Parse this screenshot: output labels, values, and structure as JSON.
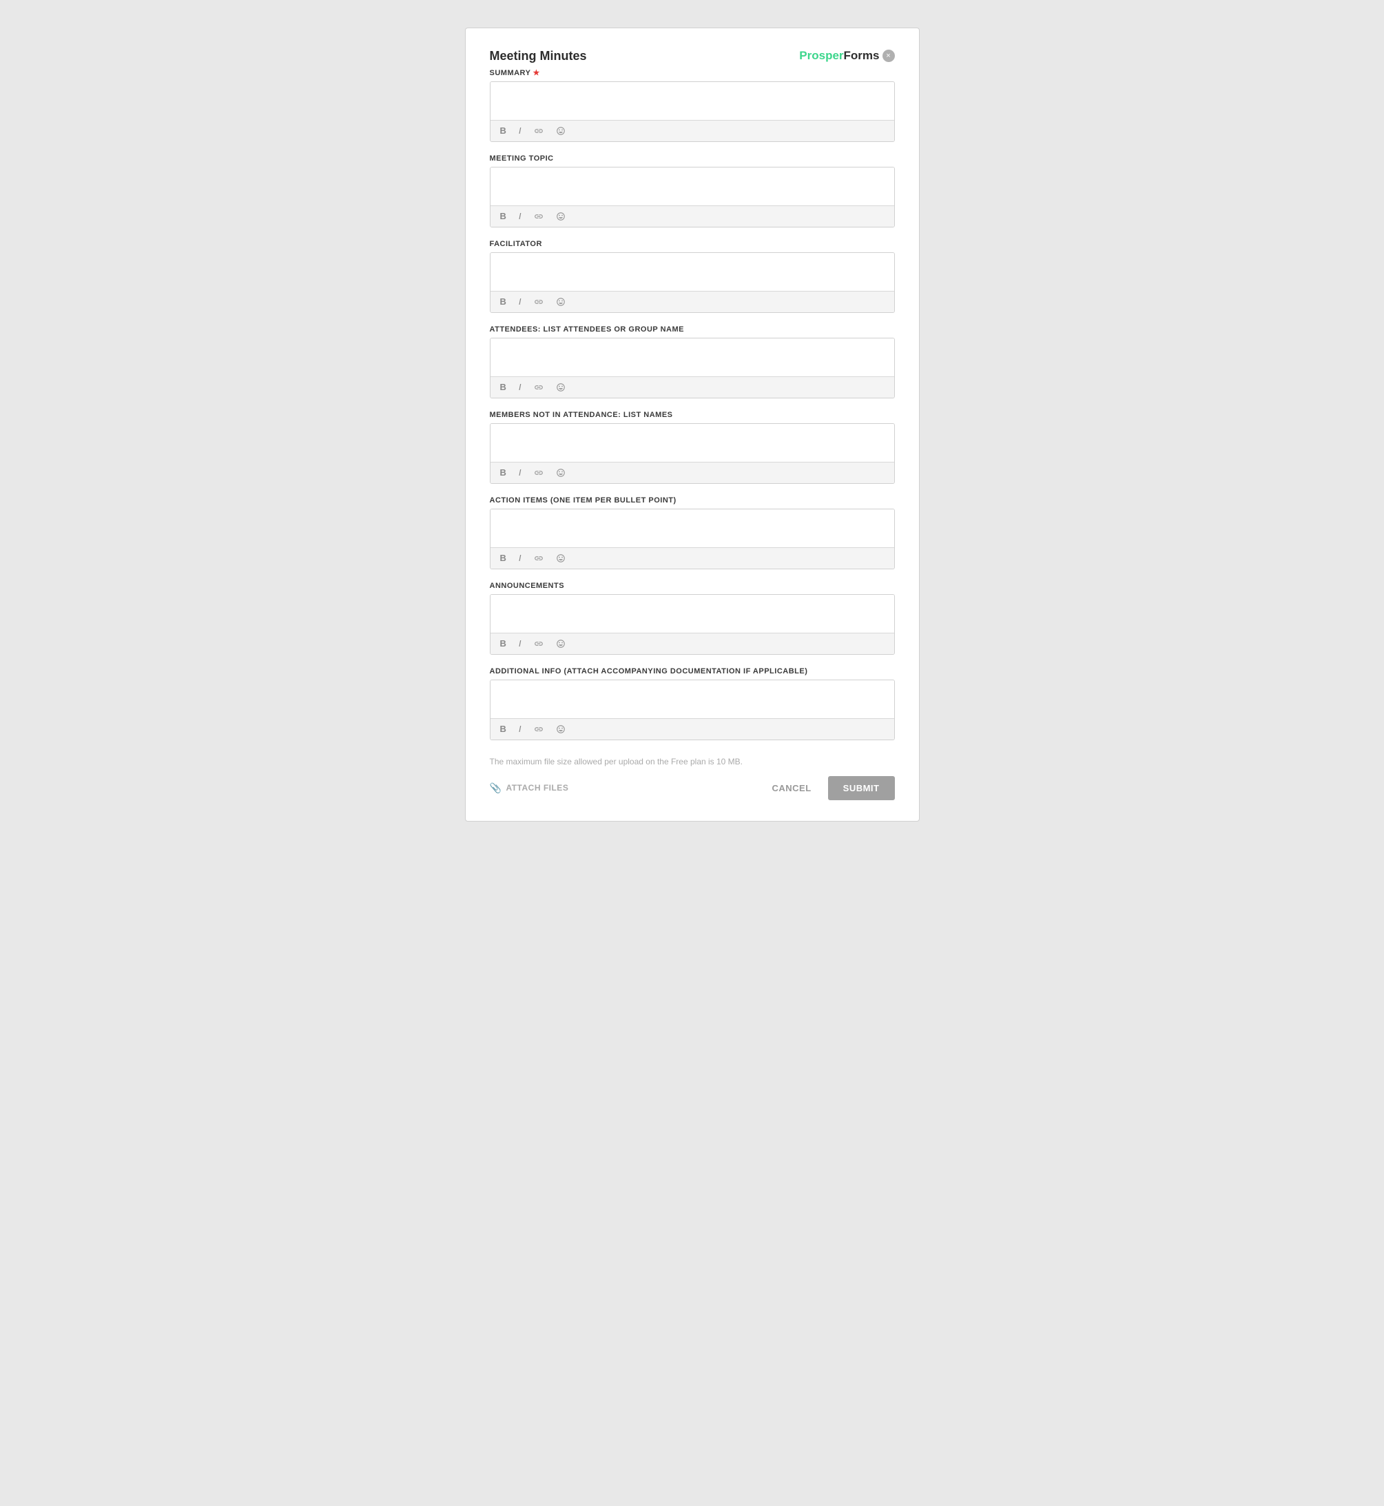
{
  "header": {
    "title": "Meeting Minutes",
    "logo_prosper": "Prosper",
    "logo_forms": "Forms",
    "close_label": "×"
  },
  "fields": [
    {
      "id": "summary",
      "label": "SUMMARY",
      "required": true,
      "placeholder": ""
    },
    {
      "id": "meeting_topic",
      "label": "MEETING TOPIC",
      "required": false,
      "placeholder": ""
    },
    {
      "id": "facilitator",
      "label": "FACILITATOR",
      "required": false,
      "placeholder": ""
    },
    {
      "id": "attendees",
      "label": "ATTENDEES: LIST ATTENDEES OR GROUP NAME",
      "required": false,
      "placeholder": ""
    },
    {
      "id": "members_not_attending",
      "label": "MEMBERS NOT IN ATTENDANCE: LIST NAMES",
      "required": false,
      "placeholder": ""
    },
    {
      "id": "action_items",
      "label": "ACTION ITEMS (ONE ITEM PER BULLET POINT)",
      "required": false,
      "placeholder": ""
    },
    {
      "id": "announcements",
      "label": "ANNOUNCEMENTS",
      "required": false,
      "placeholder": ""
    },
    {
      "id": "additional_info",
      "label": "ADDITIONAL INFO (ATTACH ACCOMPANYING DOCUMENTATION IF APPLICABLE)",
      "required": false,
      "placeholder": ""
    }
  ],
  "toolbar": {
    "bold": "B",
    "italic": "I"
  },
  "footer": {
    "file_size_note": "The maximum file size allowed per upload on the Free plan is 10 MB.",
    "attach_label": "ATTACH FILES",
    "cancel_label": "CANCEL",
    "submit_label": "SUBMIT"
  }
}
